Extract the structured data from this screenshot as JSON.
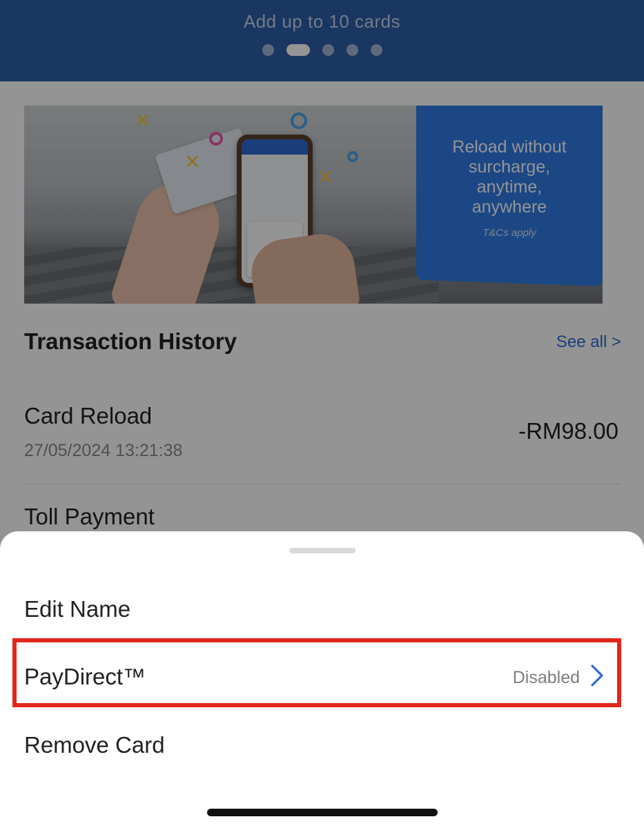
{
  "header": {
    "hint": "Add up to 10 cards",
    "pager": {
      "count": 5,
      "active_index": 1
    }
  },
  "banner": {
    "headline": "Reload without surcharge, anytime, anywhere",
    "headline_lines": [
      "Reload without",
      "surcharge,",
      "anytime,",
      "anywhere"
    ],
    "terms": "T&Cs apply"
  },
  "transactions": {
    "title": "Transaction History",
    "see_all": "See all >",
    "items": [
      {
        "title": "Card Reload",
        "date": "27/05/2024 13:21:38",
        "amount": "-RM98.00"
      },
      {
        "title": "Toll Payment",
        "date": "",
        "amount": ""
      }
    ]
  },
  "sheet": {
    "items": [
      {
        "label": "Edit Name"
      },
      {
        "label": "PayDirect™",
        "status": "Disabled"
      },
      {
        "label": "Remove Card"
      }
    ]
  },
  "colors": {
    "header_bg": "#2e5fa8",
    "accent": "#2e6bd1",
    "highlight": "#e2261b"
  }
}
